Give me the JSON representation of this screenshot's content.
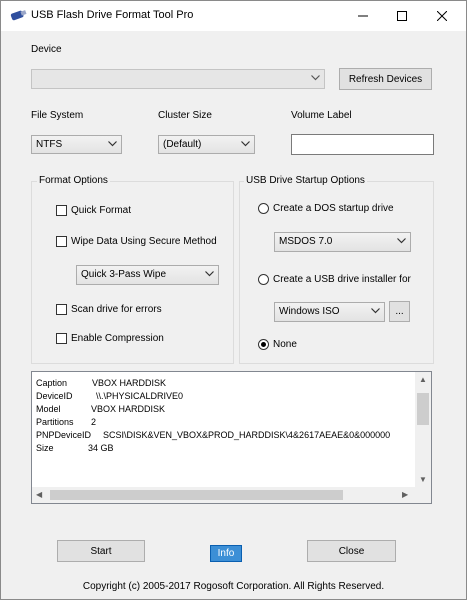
{
  "window": {
    "title": "USB Flash Drive Format Tool Pro"
  },
  "device": {
    "label": "Device",
    "value": "",
    "refresh_button": "Refresh Devices"
  },
  "file_system": {
    "label": "File System",
    "value": "NTFS"
  },
  "cluster_size": {
    "label": "Cluster Size",
    "value": "(Default)"
  },
  "volume_label": {
    "label": "Volume Label",
    "value": ""
  },
  "format_options": {
    "title": "Format Options",
    "quick_format": "Quick Format",
    "wipe_data": "Wipe Data Using Secure Method",
    "wipe_method": "Quick 3-Pass Wipe",
    "scan_errors": "Scan drive for errors",
    "enable_compression": "Enable Compression"
  },
  "startup_options": {
    "title": "USB Drive Startup Options",
    "dos_radio": "Create a DOS startup drive",
    "dos_version": "MSDOS 7.0",
    "installer_radio": "Create a USB drive installer for",
    "installer_source": "Windows ISO",
    "browse_button": "...",
    "none_radio": "None"
  },
  "drive_info": [
    {
      "key": "Caption",
      "value": "VBOX HARDDISK"
    },
    {
      "key": "DeviceID",
      "value": "\\\\.\\PHYSICALDRIVE0"
    },
    {
      "key": "Model",
      "value": "VBOX HARDDISK"
    },
    {
      "key": "Partitions",
      "value": "2"
    },
    {
      "key": "PNPDeviceID",
      "value": "SCSI\\DISK&VEN_VBOX&PROD_HARDDISK\\4&2617AEAE&0&000000"
    },
    {
      "key": "Size",
      "value": "34 GB"
    }
  ],
  "buttons": {
    "start": "Start",
    "info": "Info",
    "close": "Close"
  },
  "footer": {
    "copyright": "Copyright (c) 2005-2017 Rogosoft Corporation. All Rights Reserved."
  }
}
